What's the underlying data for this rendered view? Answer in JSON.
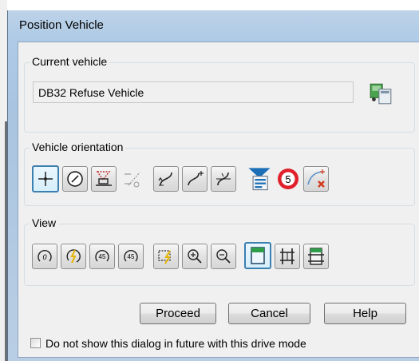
{
  "window": {
    "title": "Position Vehicle"
  },
  "current_vehicle": {
    "group_label": "Current vehicle",
    "value": "DB32 Refuse Vehicle",
    "icon": "vehicle-library-icon"
  },
  "orientation": {
    "group_label": "Vehicle orientation",
    "buttons": [
      {
        "icon": "crosshair-position-icon"
      },
      {
        "icon": "rotate-dial-icon"
      },
      {
        "icon": "align-vehicle-icon"
      },
      {
        "icon": "snap-path-icon"
      },
      {
        "icon": "curve-left-icon"
      },
      {
        "icon": "curve-right-icon"
      },
      {
        "icon": "curve-split-icon"
      },
      {
        "icon": "vehicle-properties-icon"
      },
      {
        "icon": "speed-limit-icon",
        "text": "5"
      },
      {
        "icon": "delete-path-icon"
      }
    ]
  },
  "view": {
    "group_label": "View",
    "buttons": [
      {
        "icon": "reset-rotation-icon",
        "text": "0"
      },
      {
        "icon": "rotate-quick-icon"
      },
      {
        "icon": "rotate-45-left-icon",
        "text": "45"
      },
      {
        "icon": "rotate-45-right-icon",
        "text": "45"
      },
      {
        "icon": "zoom-extents-icon"
      },
      {
        "icon": "zoom-in-icon"
      },
      {
        "icon": "zoom-out-icon"
      },
      {
        "icon": "vehicle-view-icon"
      },
      {
        "icon": "axle-view-icon"
      },
      {
        "icon": "chassis-view-icon"
      }
    ]
  },
  "actions": {
    "proceed": "Proceed",
    "cancel": "Cancel",
    "help": "Help"
  },
  "checkbox": {
    "label": "Do not show this dialog in future with this drive mode",
    "checked": false
  },
  "colors": {
    "accent": "#3c7fb1",
    "speed_limit_red": "#e0202a",
    "delete_red": "#d23a1e",
    "vehicle_green": "#2e9e4a"
  }
}
